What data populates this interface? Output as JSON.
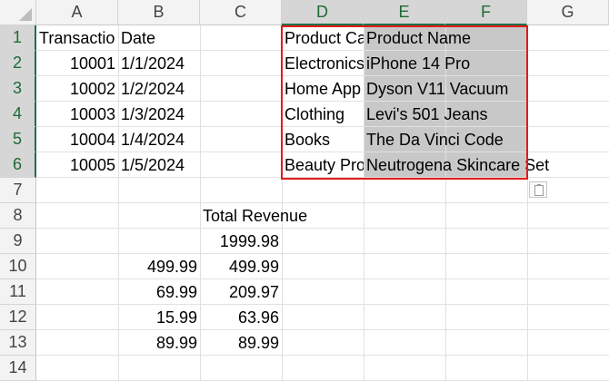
{
  "columns": [
    "A",
    "B",
    "C",
    "D",
    "E",
    "F",
    "G"
  ],
  "rows": [
    "1",
    "2",
    "3",
    "4",
    "5",
    "6",
    "7",
    "8",
    "9",
    "10",
    "11",
    "12",
    "13",
    "14"
  ],
  "selected_columns": [
    "D",
    "E",
    "F"
  ],
  "selected_rows": [
    "1",
    "2",
    "3",
    "4",
    "5",
    "6"
  ],
  "cells": {
    "A1": "Transactio",
    "B1": "Date",
    "D1": "Product Ca",
    "E1": "Product Name",
    "A2": "10001",
    "B2": "1/1/2024",
    "D2": "Electronics",
    "E2": "iPhone 14 Pro",
    "A3": "10002",
    "B3": "1/2/2024",
    "D3": "Home App",
    "E3": "Dyson V11 Vacuum",
    "A4": "10003",
    "B4": "1/3/2024",
    "D4": "Clothing",
    "E4": "Levi's 501 Jeans",
    "A5": "10004",
    "B5": "1/4/2024",
    "D5": "Books",
    "E5": "The Da Vinci Code",
    "A6": "10005",
    "B6": "1/5/2024",
    "D6": "Beauty Pro",
    "E6": "Neutrogena Skincare Set",
    "C8": "Total Revenue",
    "C9": "1999.98",
    "B10": "499.99",
    "C10": "499.99",
    "B11": "69.99",
    "C11": "209.97",
    "B12": "15.99",
    "C12": "63.96",
    "B13": "89.99",
    "C13": "89.99"
  },
  "colors": {
    "selection_border": "#e21b1b",
    "selection_fill": "#c8c8c8",
    "header_selected_text": "#1e6b33"
  },
  "icons": {
    "paste_options": "paste-options-icon"
  }
}
